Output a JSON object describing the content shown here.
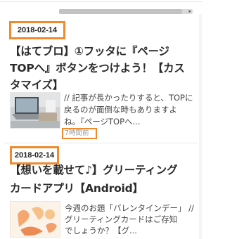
{
  "articles": [
    {
      "date": "2018-02-14",
      "title_line1": "【はてブロ】①フッタに『ページ",
      "title_line2": "TOPへ』ボタンをつけよう！【カス",
      "title_line3": "タマイズ】",
      "excerpt_line1": "// 記事が長かったりすると、TOPに",
      "excerpt_line2": "戻るのが面倒な時もありますよ",
      "excerpt_line3": "ね。『ページTOPへ...",
      "time_ago": "7時間前"
    },
    {
      "date": "2018-02-14",
      "title_line1": "【想いを載せて♪】グリーティング",
      "title_line2": "カードアプリ【Android】",
      "excerpt_line1": "今週のお題「バレンタインデー」 //",
      "excerpt_line2": "グリーティングカードはご存知",
      "excerpt_line3": "でしょうか？【グ..."
    }
  ],
  "colors": {
    "highlight": "#f08a2c",
    "title": "#2b2b2b",
    "excerpt": "#444444",
    "meta": "#9a9a9a"
  }
}
